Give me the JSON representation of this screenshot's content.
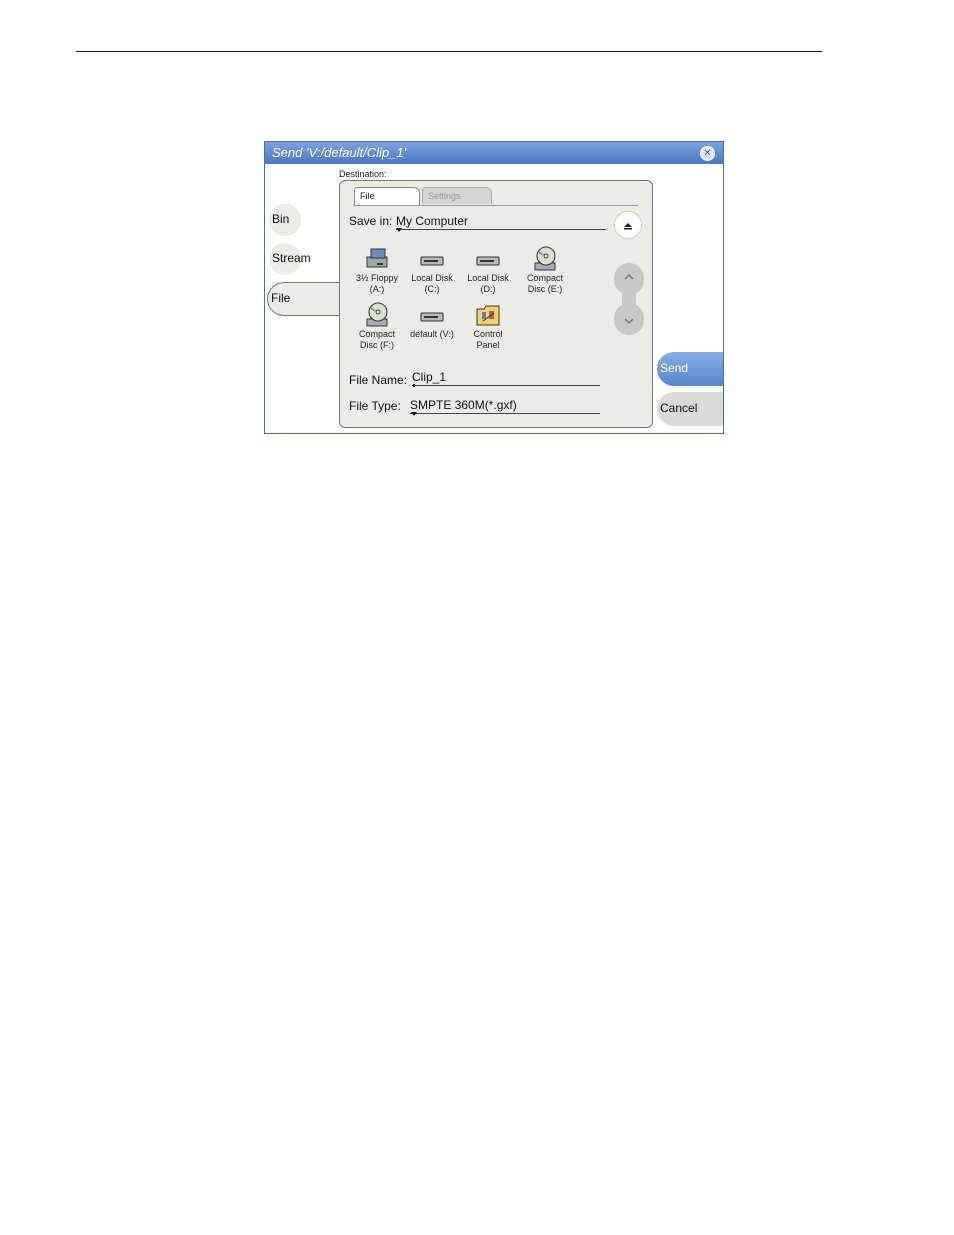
{
  "dialog": {
    "title": "Send 'V:/default/Clip_1'",
    "close_glyph": "✕"
  },
  "side_tabs": [
    {
      "label": "Bin"
    },
    {
      "label": "Stream"
    },
    {
      "label": "File"
    }
  ],
  "destination_label": "Destination:",
  "tabs": [
    {
      "label": "File"
    },
    {
      "label": "Settings"
    }
  ],
  "save_in": {
    "label": "Save in:",
    "value": "My Computer"
  },
  "up_button": {
    "icon": "up-folder-icon"
  },
  "items": [
    {
      "line1": "3½ Floppy",
      "line2": "(A:)",
      "icon": "floppy-drive-icon"
    },
    {
      "line1": "Local Disk",
      "line2": "(C:)",
      "icon": "hard-disk-icon"
    },
    {
      "line1": "Local Disk",
      "line2": "(D:)",
      "icon": "hard-disk-icon"
    },
    {
      "line1": "Compact",
      "line2": "Disc (E:)",
      "icon": "cd-drive-icon"
    },
    {
      "line1": "Compact",
      "line2": "Disc (F:)",
      "icon": "cd-drive-icon"
    },
    {
      "line1": "default (V:)",
      "line2": "",
      "icon": "hard-disk-icon"
    },
    {
      "line1": "Control",
      "line2": "Panel",
      "icon": "control-panel-folder-icon"
    }
  ],
  "file_name": {
    "label": "File Name:",
    "value": "Clip_1"
  },
  "file_type": {
    "label": "File Type:",
    "value": "SMPTE 360M(*.gxf)"
  },
  "buttons": {
    "send": "Send",
    "cancel": "Cancel"
  },
  "colors": {
    "title_bar": "#4a76c2",
    "panel": "#ecece6",
    "send": "#5a86cc"
  }
}
